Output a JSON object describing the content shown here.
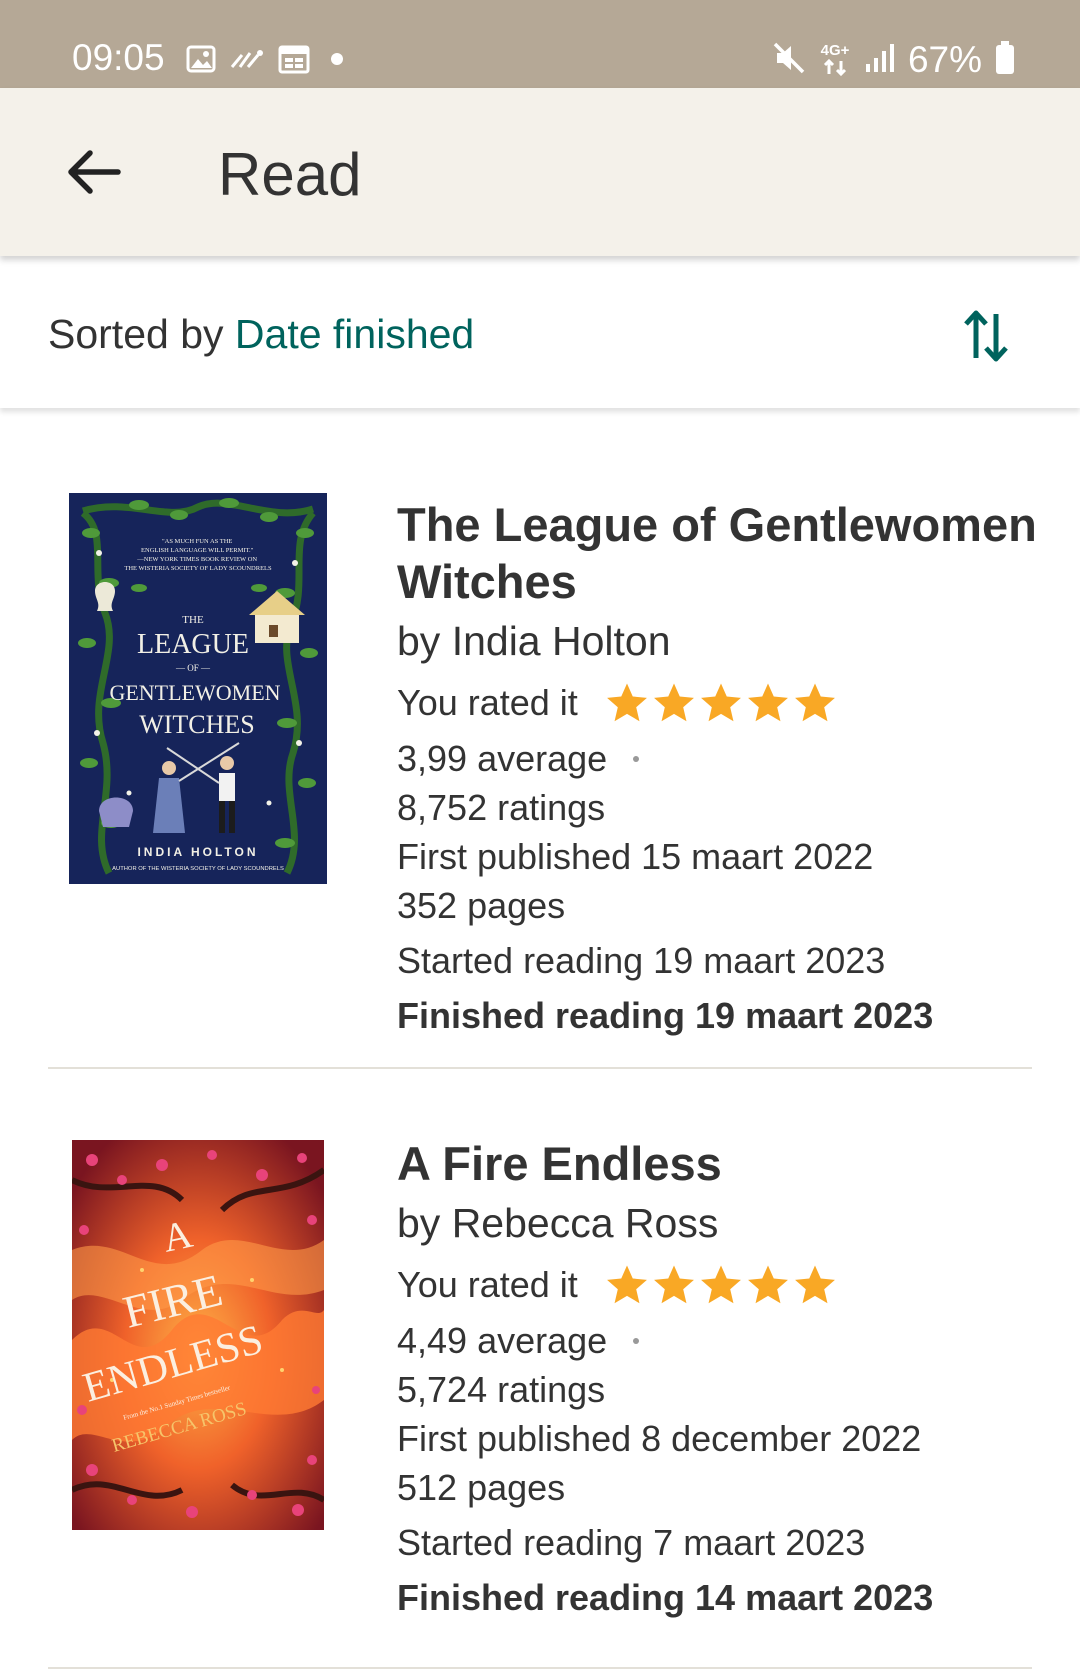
{
  "status_bar": {
    "time": "09:05",
    "battery": "67%",
    "network": "4G+",
    "icons_left": [
      "gallery-icon",
      "missed-call-icon",
      "calendar-icon",
      "notification-dot-icon"
    ],
    "icons_right": [
      "mute-icon",
      "network-4g-icon",
      "signal-icon",
      "battery-icon"
    ]
  },
  "app_bar": {
    "title": "Read",
    "back_icon": "arrow-left-icon"
  },
  "sort": {
    "label": "Sorted by",
    "value": "Date finished",
    "toggle_icon": "sort-direction-icon"
  },
  "colors": {
    "status_bar_bg": "#b5a896",
    "app_bar_bg": "#f4f1ea",
    "accent_teal": "#00635d",
    "star": "#f9a825",
    "text": "#333333"
  },
  "books": [
    {
      "title": "The League of Gentlewomen Witches",
      "author": "by India Holton",
      "rated_label": "You rated it",
      "rating": 5,
      "average": "3,99 average",
      "ratings": "8,752 ratings",
      "first_published": "First published 15 maart 2022",
      "pages": "352 pages",
      "started": "Started reading 19 maart 2023",
      "finished": "Finished reading 19 maart 2023",
      "cover": {
        "top_quote": "\"As much fun as the English language will permit.\" —New York Times Book Review on The Wisteria Society of Lady Scoundrels",
        "the": "THE",
        "title_line1": "LEAGUE",
        "of": "— OF —",
        "title_line2": "GENTLEWOMEN",
        "title_line3": "WITCHES",
        "author": "INDIA HOLTON",
        "tagline": "AUTHOR OF THE WISTERIA SOCIETY OF LADY SCOUNDRELS"
      }
    },
    {
      "title": "A Fire Endless",
      "author": "by Rebecca Ross",
      "rated_label": "You rated it",
      "rating": 5,
      "average": "4,49 average",
      "ratings": "5,724 ratings",
      "first_published": "First published 8 december 2022",
      "pages": "512 pages",
      "started": "Started reading 7 maart 2023",
      "finished": "Finished reading 14 maart 2023",
      "cover": {
        "title_line1": "A",
        "title_line2": "FIRE",
        "title_line3": "ENDLESS",
        "tagline": "From the No.1 Sunday Times bestseller",
        "author": "REBECCA ROSS"
      }
    }
  ]
}
